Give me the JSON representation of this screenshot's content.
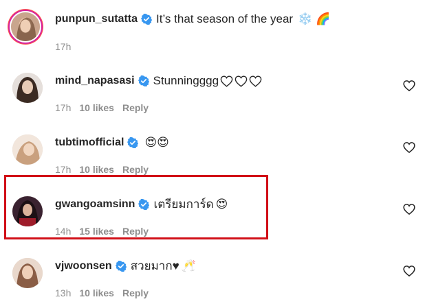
{
  "comments": [
    {
      "username": "punpun_sutatta",
      "text": "It’s that season of the year",
      "emoji_text": "❄️ 🌈",
      "time": "17h",
      "likes": "",
      "reply": ""
    },
    {
      "username": "mind_napasasi",
      "text": "Stunningggg",
      "emoji_text": "",
      "time": "17h",
      "likes": "10 likes",
      "reply": "Reply"
    },
    {
      "username": "tubtimofficial",
      "text": "",
      "emoji_text": "😍😍",
      "time": "17h",
      "likes": "10 likes",
      "reply": "Reply"
    },
    {
      "username": "gwangoamsinn",
      "text": "เตรียมการ์ด",
      "emoji_text": "😍",
      "time": "14h",
      "likes": "15 likes",
      "reply": "Reply"
    },
    {
      "username": "vjwoonsen",
      "text": "สวยมาก♥",
      "emoji_text": "🥂",
      "time": "13h",
      "likes": "10 likes",
      "reply": "Reply"
    }
  ],
  "icons": {
    "verified": "verified-badge-icon",
    "like": "heart-outline-icon"
  },
  "colors": {
    "verified": "#3897f0",
    "highlight_border": "#d10f17",
    "meta_text": "#8e8e8e"
  }
}
